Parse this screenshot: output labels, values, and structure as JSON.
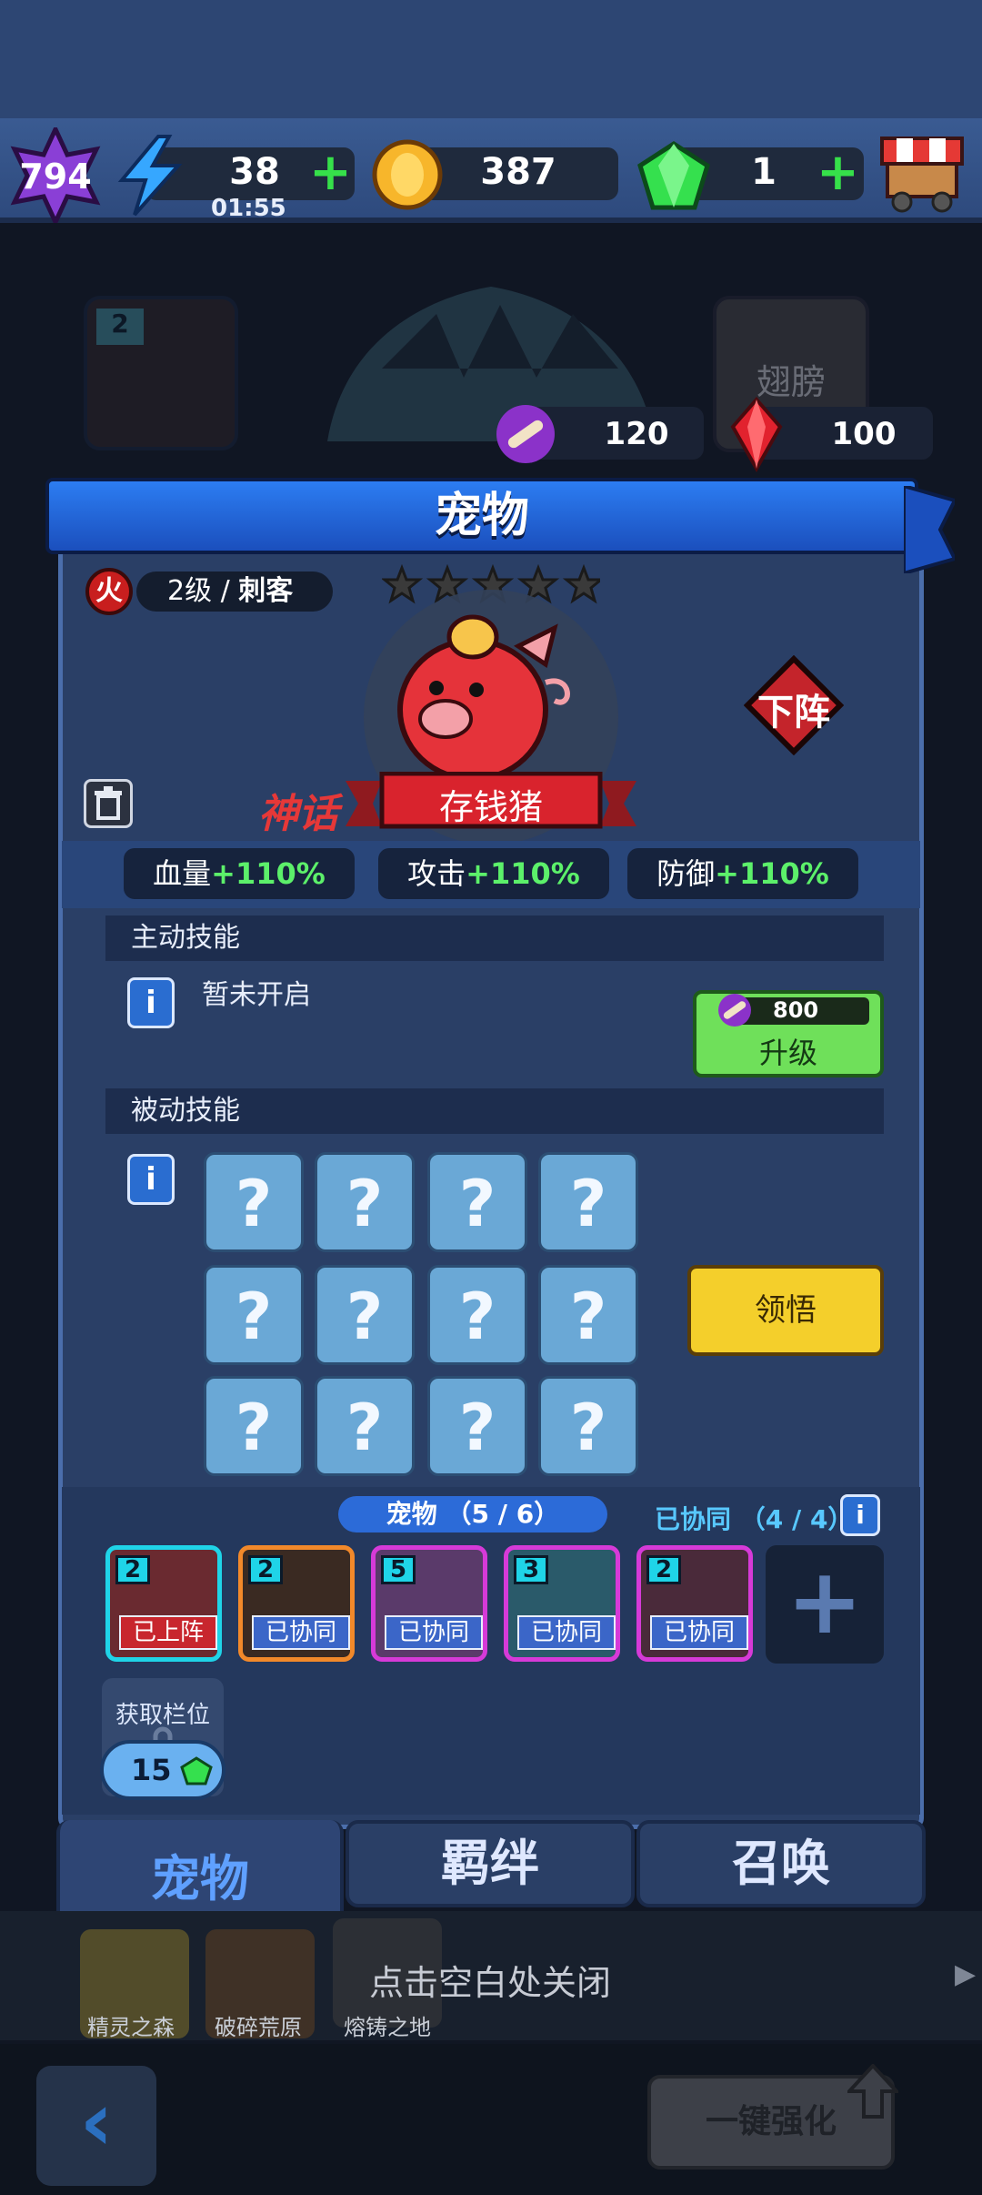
{
  "resources": {
    "level": "794",
    "energy": "38",
    "energy_timer": "01:55",
    "coins": "387",
    "gems": "1"
  },
  "backdrop": {
    "slot_level": "2",
    "wing_label": "翅膀",
    "bone_cost": "120",
    "crystal_cost": "100"
  },
  "panel": {
    "title": "宠物",
    "element": "火",
    "level_class_prefix": "2级 / ",
    "class_name": "刺客",
    "stars_count": 5,
    "rarity": "神话",
    "pet_name": "存钱猪",
    "unequip_label": "下阵",
    "stats": [
      {
        "label": "血量",
        "value": "+110%"
      },
      {
        "label": "攻击",
        "value": "+110%"
      },
      {
        "label": "防御",
        "value": "+110%"
      }
    ],
    "active_skill_header": "主动技能",
    "active_skill_text": "暂未开启",
    "upgrade_cost": "800",
    "upgrade_label": "升级",
    "passive_skill_header": "被动技能",
    "passive_unknown": "?",
    "comprehend_label": "领悟",
    "roster_label": "宠物 （5 / 6）",
    "synergy_label": "已协同 （4 / 4）",
    "pets": [
      {
        "level": "2",
        "tag": "已上阵"
      },
      {
        "level": "2",
        "tag": "已协同"
      },
      {
        "level": "5",
        "tag": "已协同"
      },
      {
        "level": "3",
        "tag": "已协同"
      },
      {
        "level": "2",
        "tag": "已协同"
      }
    ],
    "get_slot_label": "获取栏位",
    "slot_cost": "15"
  },
  "tabs": {
    "pet": "宠物",
    "bond": "羁绊",
    "summon": "召唤"
  },
  "close_hint": "点击空白处关闭",
  "map": {
    "items": [
      "精灵之森",
      "破碎荒原",
      "熔铸之地"
    ]
  },
  "bottom": {
    "auto_upgrade": "一键强化"
  },
  "colors": {
    "accent_green": "#5cf06a",
    "gold_button": "#f4cf2b",
    "upgrade_button": "#6fe05a",
    "banner_blue": "#2c7df2",
    "red_ribbon": "#d9232d"
  }
}
